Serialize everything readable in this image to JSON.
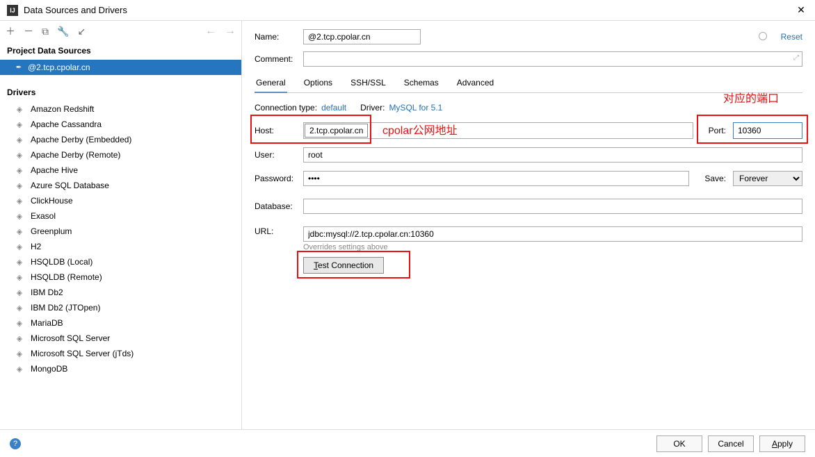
{
  "window": {
    "title": "Data Sources and Drivers",
    "app_icon_text": "IJ"
  },
  "sidebar": {
    "sources_header": "Project Data Sources",
    "selected_source": "@2.tcp.cpolar.cn",
    "drivers_header": "Drivers",
    "drivers": [
      "Amazon Redshift",
      "Apache Cassandra",
      "Apache Derby (Embedded)",
      "Apache Derby (Remote)",
      "Apache Hive",
      "Azure SQL Database",
      "ClickHouse",
      "Exasol",
      "Greenplum",
      "H2",
      "HSQLDB (Local)",
      "HSQLDB (Remote)",
      "IBM Db2",
      "IBM Db2 (JTOpen)",
      "MariaDB",
      "Microsoft SQL Server",
      "Microsoft SQL Server (jTds)",
      "MongoDB"
    ]
  },
  "form": {
    "name_label": "Name:",
    "name_value": "@2.tcp.cpolar.cn",
    "reset": "Reset",
    "comment_label": "Comment:",
    "tabs": [
      "General",
      "Options",
      "SSH/SSL",
      "Schemas",
      "Advanced"
    ],
    "conn_type_label": "Connection type:",
    "conn_type_value": "default",
    "driver_label": "Driver:",
    "driver_value": "MySQL for 5.1",
    "host_label": "Host:",
    "host_value": "2.tcp.cpolar.cn",
    "port_label": "Port:",
    "port_value": "10360",
    "user_label": "User:",
    "user_value": "root",
    "password_label": "Password:",
    "password_value": "••••",
    "save_label": "Save:",
    "save_value": "Forever",
    "database_label": "Database:",
    "database_value": "",
    "url_label": "URL:",
    "url_value": "jdbc:mysql://2.tcp.cpolar.cn:10360",
    "url_hint": "Overrides settings above",
    "test_button": "Test Connection"
  },
  "annotations": {
    "host_note": "cpolar公网地址",
    "port_note": "对应的端口"
  },
  "footer": {
    "ok": "OK",
    "cancel": "Cancel",
    "apply": "Apply"
  }
}
